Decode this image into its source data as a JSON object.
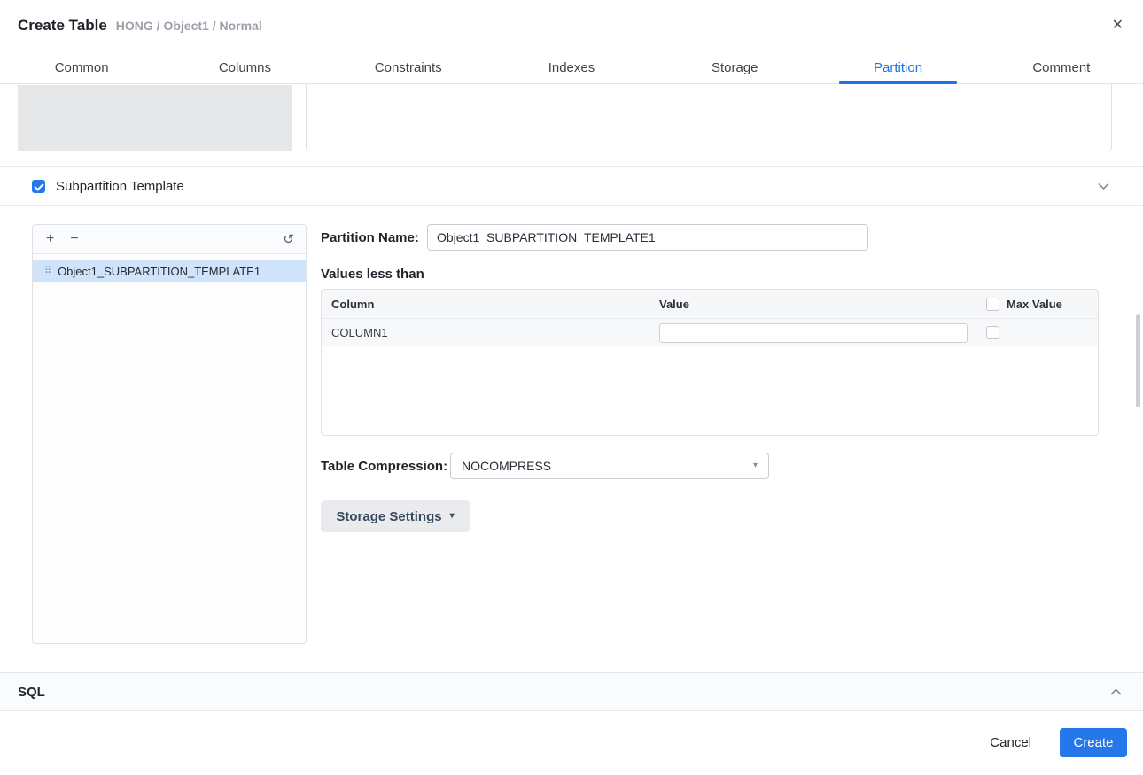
{
  "colors": {
    "accent": "#1f72e5",
    "create_button": "#2577ea",
    "selected_item_bg": "#cfe4fb",
    "checkbox_checked": "#2577ea"
  },
  "header": {
    "title": "Create Table",
    "breadcrumb": "HONG / Object1 / Normal",
    "close_glyph": "✕"
  },
  "tabs": [
    {
      "label": "Common",
      "active": false
    },
    {
      "label": "Columns",
      "active": false
    },
    {
      "label": "Constraints",
      "active": false
    },
    {
      "label": "Indexes",
      "active": false
    },
    {
      "label": "Storage",
      "active": false
    },
    {
      "label": "Partition",
      "active": true
    },
    {
      "label": "Comment",
      "active": false
    }
  ],
  "subpartition": {
    "checkbox_checked": true,
    "title": "Subpartition Template",
    "toolbar": {
      "add_glyph": "+",
      "remove_glyph": "−",
      "refresh_glyph": "↺"
    },
    "list": {
      "selected_index": 0,
      "items": [
        {
          "drag_glyph": "⠿",
          "label": "Object1_SUBPARTITION_TEMPLATE1"
        }
      ]
    },
    "form": {
      "partition_name_label": "Partition Name:",
      "partition_name_value": "Object1_SUBPARTITION_TEMPLATE1",
      "values_section_label": "Values less than",
      "values_table": {
        "columns": [
          "Column",
          "Value",
          "Max Value"
        ],
        "rows": [
          {
            "column": "COLUMN1",
            "value": "",
            "max_value_checked": false
          }
        ]
      },
      "compression_label": "Table Compression:",
      "compression_value": "NOCOMPRESS",
      "dropdown_glyph": "▾",
      "storage_settings_label": "Storage Settings"
    }
  },
  "sql_section": {
    "label": "SQL"
  },
  "footer": {
    "cancel_label": "Cancel",
    "create_label": "Create"
  }
}
